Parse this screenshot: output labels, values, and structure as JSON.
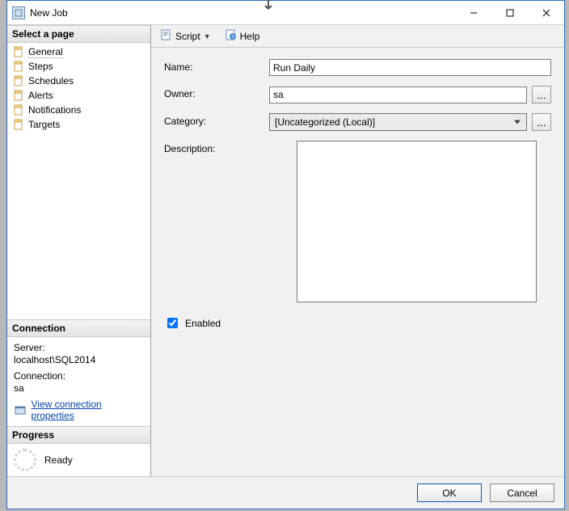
{
  "title": "New Job",
  "win_controls": {
    "min": "Minimize",
    "max": "Maximize",
    "close": "Close"
  },
  "sidebar": {
    "select_header": "Select a page",
    "items": [
      {
        "label": "General"
      },
      {
        "label": "Steps"
      },
      {
        "label": "Schedules"
      },
      {
        "label": "Alerts"
      },
      {
        "label": "Notifications"
      },
      {
        "label": "Targets"
      }
    ],
    "connection": {
      "header": "Connection",
      "server_label": "Server:",
      "server_value": "localhost\\SQL2014",
      "conn_label": "Connection:",
      "conn_value": "sa",
      "view_link": "View connection properties"
    },
    "progress": {
      "header": "Progress",
      "status": "Ready"
    }
  },
  "toolbar": {
    "script": "Script",
    "help": "Help"
  },
  "form": {
    "name_label": "Name:",
    "name_value": "Run Daily",
    "owner_label": "Owner:",
    "owner_value": "sa",
    "owner_browse": "...",
    "category_label": "Category:",
    "category_value": "[Uncategorized (Local)]",
    "category_browse": "...",
    "description_label": "Description:",
    "description_value": "",
    "enabled_label": "Enabled",
    "enabled_checked": true
  },
  "footer": {
    "ok": "OK",
    "cancel": "Cancel"
  }
}
